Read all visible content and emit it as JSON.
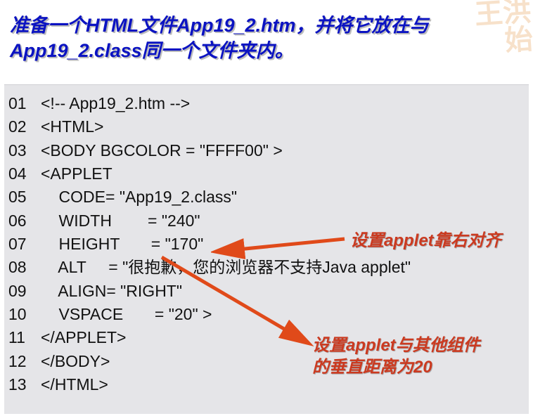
{
  "title": "准备一个HTML文件App19_2.htm，并将它放在与App19_2.class同一个文件夹内。",
  "watermark": "王洪\n始",
  "code": [
    {
      "n": "01",
      "t": "<!-- App19_2.htm -->"
    },
    {
      "n": "02",
      "t": "<HTML>"
    },
    {
      "n": "03",
      "t": "<BODY BGCOLOR = \"FFFF00\" >"
    },
    {
      "n": "04",
      "t": "<APPLET"
    },
    {
      "n": "05",
      "t": "    CODE= \"App19_2.class\""
    },
    {
      "n": "06",
      "t": "    WIDTH        = \"240\""
    },
    {
      "n": "07",
      "t": "    HEIGHT       = \"170\""
    },
    {
      "n": "08",
      "t": "    ALT     = \"很抱歉，您的浏览器不支持Java applet\""
    },
    {
      "n": "09",
      "t": "    ALIGN= \"RIGHT\""
    },
    {
      "n": "10",
      "t": "    VSPACE       = \"20\" >"
    },
    {
      "n": "11",
      "t": "</APPLET>"
    },
    {
      "n": "12",
      "t": "</BODY>"
    },
    {
      "n": "13",
      "t": "</HTML>"
    }
  ],
  "annotations": [
    {
      "text": "设置applet靠右对齐"
    },
    {
      "text": "设置applet与其他组件的垂直距离为20"
    }
  ]
}
